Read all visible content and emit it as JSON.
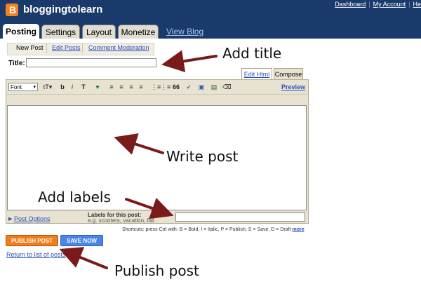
{
  "header": {
    "logo_letter": "B",
    "blog_name": "bloggingtolearn",
    "links": [
      "Dashboard",
      "My Account",
      "He"
    ]
  },
  "tabs": [
    {
      "label": "Posting",
      "active": true
    },
    {
      "label": "Settings",
      "active": false
    },
    {
      "label": "Layout",
      "active": false
    },
    {
      "label": "Monetize",
      "active": false
    }
  ],
  "view_blog": "View Blog",
  "subnav": [
    {
      "label": "New Post",
      "active": true
    },
    {
      "label": "Edit Posts",
      "active": false
    },
    {
      "label": "Comment Moderation",
      "active": false
    }
  ],
  "title_label": "Title:",
  "editor_tabs": {
    "edit_html": "Edit Html",
    "compose": "Compose"
  },
  "toolbar": {
    "font_label": "Font",
    "caret": "▾",
    "buttons": [
      "tT▾",
      "b",
      "i",
      "T",
      "♥",
      "≡",
      "≡",
      "≡",
      "≡",
      "⋮≡",
      "⋮≡",
      "66",
      "✓",
      "▣",
      "▤",
      "⌫"
    ],
    "preview": "Preview"
  },
  "post_options": "Post Options",
  "labels": {
    "title": "Labels for this post:",
    "hint": "e.g. scooters, vacation, fall"
  },
  "shortcuts": {
    "text": "Shortcuts: press Ctrl with: B = Bold, I = Italic, P = Publish, S = Save, D = Draft",
    "more": "more"
  },
  "buttons": {
    "publish": "PUBLISH POST",
    "save": "SAVE NOW"
  },
  "return_link": "Return to list of posts",
  "annotations": {
    "add_title": "Add title",
    "write_post": "Write post",
    "add_labels": "Add labels",
    "publish_post": "Publish post"
  },
  "colors": {
    "header_bg": "#1a3a6b",
    "logo": "#f58220",
    "publish": "#f07d1c",
    "save": "#4a86e8",
    "arrow": "#7a1a1a"
  }
}
